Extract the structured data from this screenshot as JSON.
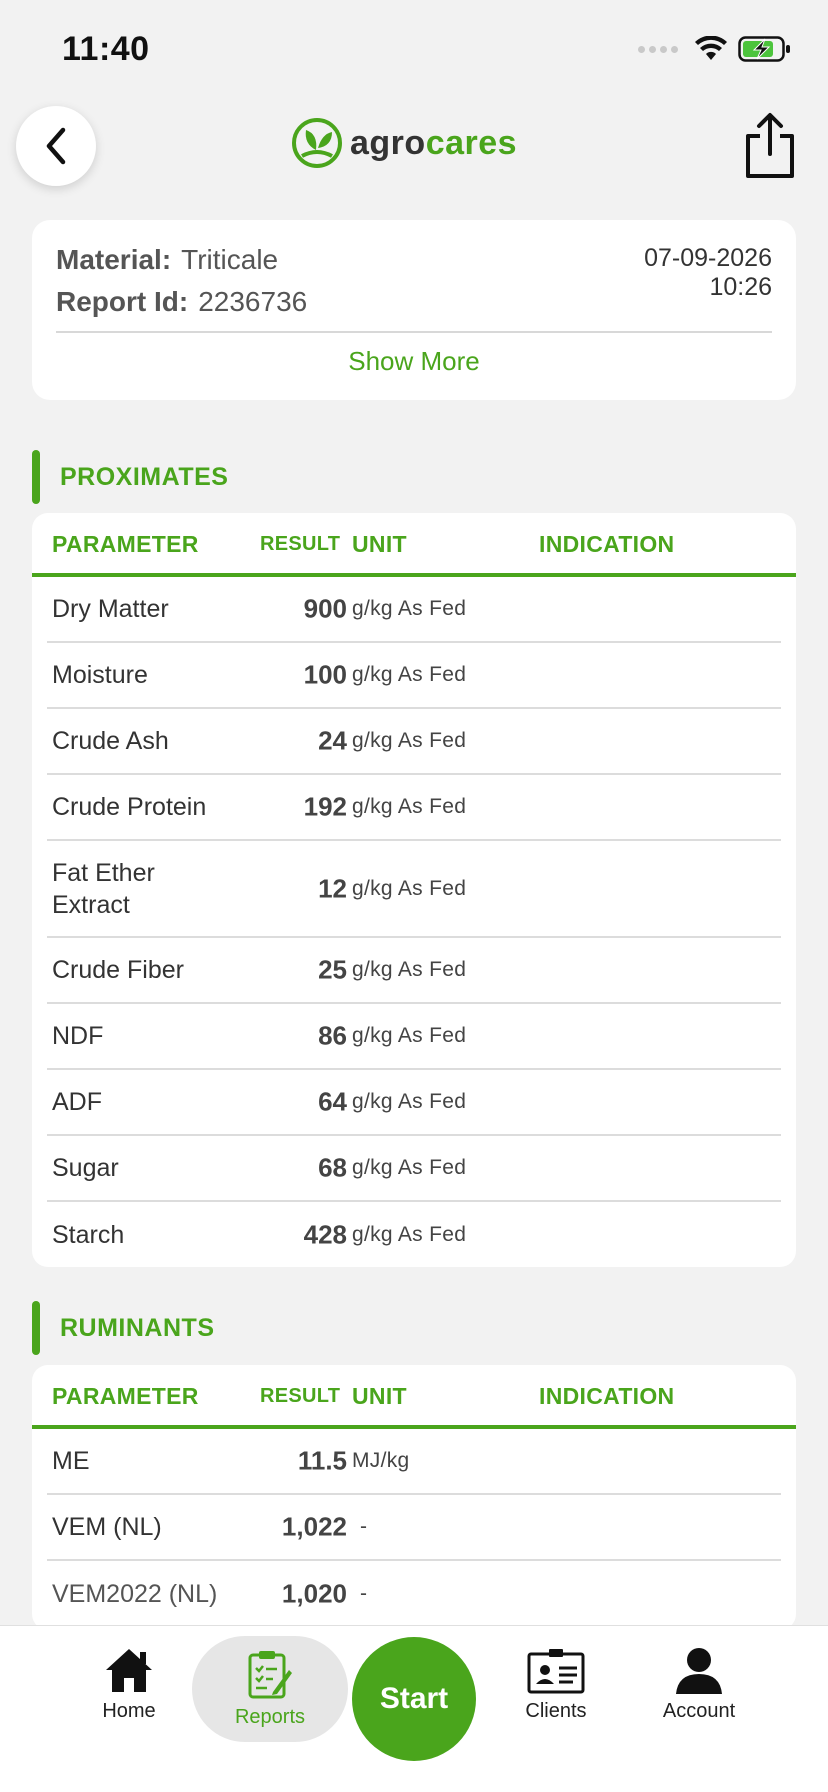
{
  "status_bar": {
    "time": "11:40"
  },
  "header": {
    "logo_part1": "agro",
    "logo_part2": "cares"
  },
  "info": {
    "material_label": "Material:",
    "material_value": "Triticale",
    "report_label": "Report Id:",
    "report_value": "2236736",
    "date": "07-09-2026",
    "time": "10:26",
    "show_more": "Show More"
  },
  "sections": {
    "proximates": {
      "title": "PROXIMATES",
      "headers": {
        "parameter": "PARAMETER",
        "result": "RESULT",
        "unit": "UNIT",
        "indication": "INDICATION"
      },
      "rows": [
        {
          "parameter": "Dry Matter",
          "result": "900",
          "unit": "g/kg As Fed"
        },
        {
          "parameter": "Moisture",
          "result": "100",
          "unit": "g/kg As Fed"
        },
        {
          "parameter": "Crude Ash",
          "result": "24",
          "unit": "g/kg As Fed"
        },
        {
          "parameter": "Crude Protein",
          "result": "192",
          "unit": "g/kg As Fed"
        },
        {
          "parameter": "Fat Ether Extract",
          "result": "12",
          "unit": "g/kg As Fed"
        },
        {
          "parameter": "Crude Fiber",
          "result": "25",
          "unit": "g/kg As Fed"
        },
        {
          "parameter": "NDF",
          "result": "86",
          "unit": "g/kg As Fed"
        },
        {
          "parameter": "ADF",
          "result": "64",
          "unit": "g/kg As Fed"
        },
        {
          "parameter": "Sugar",
          "result": "68",
          "unit": "g/kg As Fed"
        },
        {
          "parameter": "Starch",
          "result": "428",
          "unit": "g/kg As Fed"
        }
      ]
    },
    "ruminants": {
      "title": "RUMINANTS",
      "headers": {
        "parameter": "PARAMETER",
        "result": "RESULT",
        "unit": "UNIT",
        "indication": "INDICATION"
      },
      "rows": [
        {
          "parameter": "ME",
          "result": "11.5",
          "unit": "MJ/kg"
        },
        {
          "parameter": "VEM (NL)",
          "result": "1,022",
          "unit": "-"
        },
        {
          "parameter": "VEM2022 (NL)",
          "result": "1,020",
          "unit": "-"
        }
      ]
    }
  },
  "nav": {
    "home": "Home",
    "reports": "Reports",
    "start": "Start",
    "clients": "Clients",
    "account": "Account"
  },
  "colors": {
    "accent": "#4aa51c",
    "background": "#f2f2f2"
  }
}
